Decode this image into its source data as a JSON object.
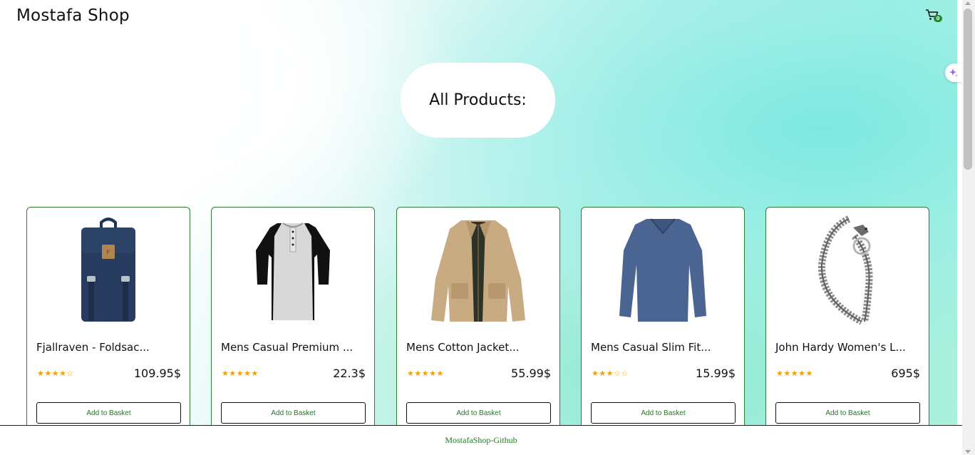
{
  "header": {
    "brand": "Mostafa Shop",
    "cart_count": "0",
    "cart_icon": "cart-icon"
  },
  "main": {
    "heading": "All Products:"
  },
  "products": [
    {
      "title": "Fjallraven - Foldsac...",
      "rating_stars": "★★★★☆",
      "price": "109.95$",
      "button": "Add to Basket",
      "image": "backpack-image"
    },
    {
      "title": "Mens Casual Premium ...",
      "rating_stars": "★★★★★",
      "price": "22.3$",
      "button": "Add to Basket",
      "image": "tshirt-image"
    },
    {
      "title": "Mens Cotton Jacket...",
      "rating_stars": "★★★★★",
      "price": "55.99$",
      "button": "Add to Basket",
      "image": "jacket-image"
    },
    {
      "title": "Mens Casual Slim Fit...",
      "rating_stars": "★★★☆☆",
      "price": "15.99$",
      "button": "Add to Basket",
      "image": "longsleeve-image"
    },
    {
      "title": "John Hardy Women's L...",
      "rating_stars": "★★★★★",
      "price": "695$",
      "button": "Add to Basket",
      "image": "bracelet-image"
    }
  ],
  "footer": {
    "link": "MostafaShop-Github"
  },
  "colors": {
    "accent_green": "#1f7a1f",
    "card_border": "#2e7d32",
    "star": "#f5a000",
    "badge": "#1f8a2d"
  }
}
